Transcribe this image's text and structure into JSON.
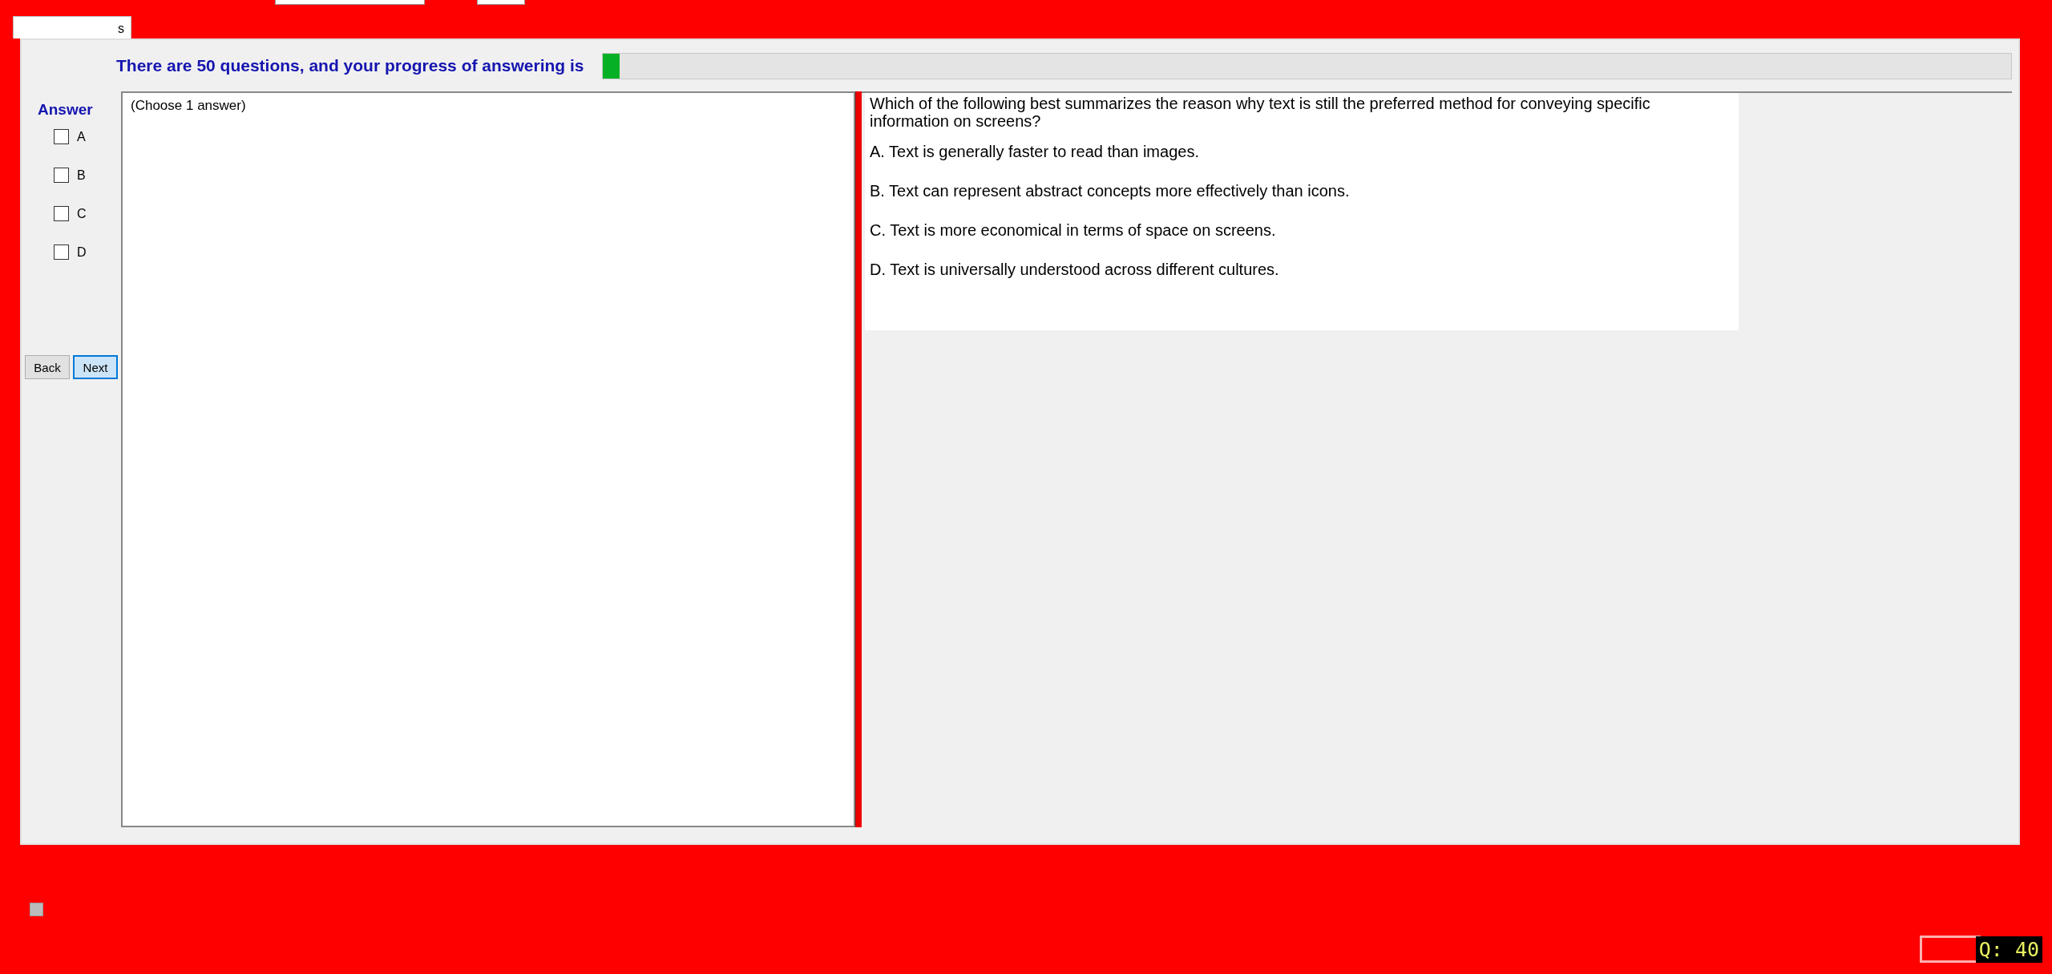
{
  "tab": {
    "label": "s",
    "selected": true
  },
  "progress": {
    "label": "There are 50 questions, and your progress of answering is",
    "level": 0.012
  },
  "answer_panel": {
    "title": "Answer",
    "options": [
      {
        "label": "A",
        "checked": false
      },
      {
        "label": "B",
        "checked": false
      },
      {
        "label": "C",
        "checked": false
      },
      {
        "label": "D",
        "checked": false
      }
    ]
  },
  "buttons": [
    {
      "label": "Back",
      "focused": false
    },
    {
      "label": "Next",
      "focused": true
    }
  ],
  "answer_box": {
    "hint": "(Choose 1 answer)"
  },
  "question": {
    "text": "Which of the following best summarizes the reason why text is still the preferred method for conveying specific information on screens?",
    "choices": [
      "A.  Text is generally faster to read than images.",
      "B.  Text can represent abstract concepts more effectively than icons.",
      "C.  Text is more economical in terms of space on screens.",
      "D.  Text is universally understood across different cultures."
    ]
  },
  "footer": {
    "finish_checked": false,
    "question_counter": "Q: 40"
  }
}
